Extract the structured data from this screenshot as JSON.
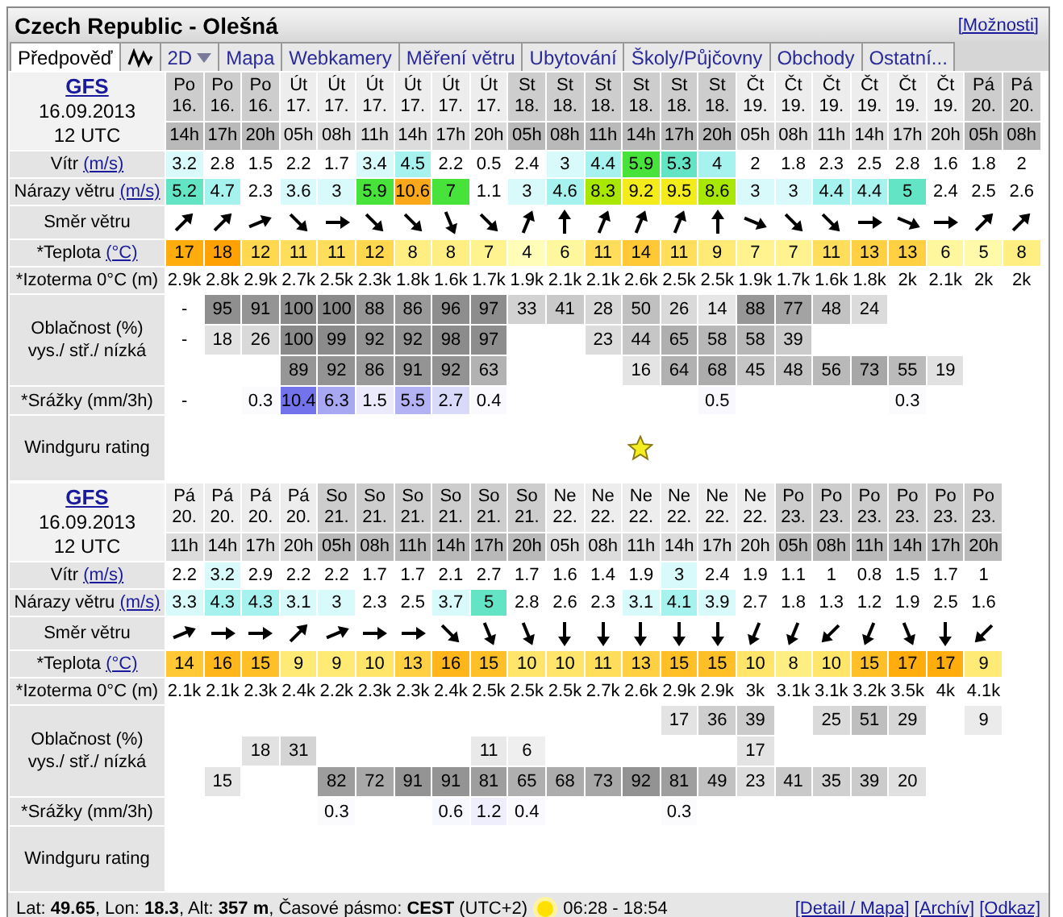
{
  "title": "Czech Republic - Olešná",
  "options_link": "[Možnosti]",
  "tabs": [
    {
      "kind": "text",
      "label": "Předpověď",
      "selected": true
    },
    {
      "kind": "graph",
      "selected": false
    },
    {
      "kind": "dropdown",
      "label": "2D",
      "selected": false
    },
    {
      "kind": "text",
      "label": "Mapa",
      "selected": false
    },
    {
      "kind": "text",
      "label": "Webkamery",
      "selected": false
    },
    {
      "kind": "text",
      "label": "Měření větru",
      "selected": false
    },
    {
      "kind": "text",
      "label": "Ubytování",
      "selected": false
    },
    {
      "kind": "text",
      "label": "Školy/Půjčovny",
      "selected": false
    },
    {
      "kind": "text",
      "label": "Obchody",
      "selected": false
    },
    {
      "kind": "text",
      "label": "Ostatní...",
      "selected": false
    }
  ],
  "blocks": [
    {
      "model": "GFS",
      "run_date": "16.09.2013",
      "run_time": "12 UTC",
      "labels": {
        "wind": "Vítr",
        "wind_unit": "(m/s)",
        "gusts": "Nárazy větru",
        "gusts_unit": "(m/s)",
        "direction": "Směr větru",
        "temperature": "*Teplota",
        "temperature_unit": "(°C)",
        "isotherm": "*Izoterma 0°C (m)",
        "cloud": "Oblačnost (%)",
        "cloud_levels": "vys./ stř./ nízká",
        "precipitation": "*Srážky (mm/3h)",
        "rating": "Windguru rating"
      },
      "columns": [
        {
          "day": "Po",
          "date": "16.",
          "hour": "14h",
          "shaded": true,
          "wind": "3.2",
          "gust": "5.2",
          "arrow": {
            "kind": "ne"
          },
          "temp": "17",
          "iso": "2.9k",
          "cloud_high": "-",
          "cloud_mid": "-",
          "rain": "-"
        },
        {
          "day": "Po",
          "date": "16.",
          "hour": "17h",
          "shaded": true,
          "wind": "2.8",
          "gust": "4.7",
          "arrow": {
            "kind": "ne"
          },
          "temp": "18",
          "iso": "2.8k",
          "cloud_high": "95",
          "cloud_mid": "18"
        },
        {
          "day": "Po",
          "date": "16.",
          "hour": "20h",
          "shaded": true,
          "wind": "1.5",
          "gust": "2.3",
          "arrow": {
            "kind": "ene"
          },
          "temp": "12",
          "iso": "2.9k",
          "cloud_high": "91",
          "cloud_mid": "26",
          "rain": "0.3"
        },
        {
          "day": "Út",
          "date": "17.",
          "hour": "05h",
          "shaded": false,
          "wind": "2.2",
          "gust": "3.6",
          "arrow": {
            "kind": "se"
          },
          "temp": "11",
          "iso": "2.7k",
          "cloud_high": "100",
          "cloud_mid": "100",
          "cloud_low": "89",
          "rain": "10.4"
        },
        {
          "day": "Út",
          "date": "17.",
          "hour": "08h",
          "shaded": false,
          "wind": "1.7",
          "gust": "3",
          "arrow": {
            "kind": "e"
          },
          "temp": "11",
          "iso": "2.5k",
          "cloud_high": "100",
          "cloud_mid": "99",
          "cloud_low": "92",
          "rain": "6.3"
        },
        {
          "day": "Út",
          "date": "17.",
          "hour": "11h",
          "shaded": false,
          "wind": "3.4",
          "gust": "5.9",
          "arrow": {
            "kind": "se"
          },
          "temp": "12",
          "iso": "2.3k",
          "cloud_high": "88",
          "cloud_mid": "92",
          "cloud_low": "86",
          "rain": "1.5"
        },
        {
          "day": "Út",
          "date": "17.",
          "hour": "14h",
          "shaded": false,
          "wind": "4.5",
          "gust": "10.6",
          "arrow": {
            "kind": "se"
          },
          "temp": "8",
          "iso": "1.8k",
          "cloud_high": "86",
          "cloud_mid": "92",
          "cloud_low": "91",
          "rain": "5.5"
        },
        {
          "day": "Út",
          "date": "17.",
          "hour": "17h",
          "shaded": false,
          "wind": "2.2",
          "gust": "7",
          "arrow": {
            "kind": "sse"
          },
          "temp": "8",
          "iso": "1.6k",
          "cloud_high": "96",
          "cloud_mid": "98",
          "cloud_low": "92",
          "rain": "2.7"
        },
        {
          "day": "Út",
          "date": "17.",
          "hour": "20h",
          "shaded": false,
          "wind": "0.5",
          "gust": "1.1",
          "arrow": {
            "kind": "se"
          },
          "temp": "7",
          "iso": "1.7k",
          "cloud_high": "97",
          "cloud_mid": "97",
          "cloud_low": "63",
          "rain": "0.4"
        },
        {
          "day": "St",
          "date": "18.",
          "hour": "05h",
          "shaded": true,
          "wind": "2.4",
          "gust": "3",
          "arrow": {
            "kind": "nne"
          },
          "temp": "4",
          "iso": "1.9k",
          "cloud_high": "33"
        },
        {
          "day": "St",
          "date": "18.",
          "hour": "08h",
          "shaded": true,
          "wind": "3",
          "gust": "4.6",
          "arrow": {
            "kind": "n"
          },
          "temp": "6",
          "iso": "2.1k",
          "cloud_high": "41"
        },
        {
          "day": "St",
          "date": "18.",
          "hour": "11h",
          "shaded": true,
          "wind": "4.4",
          "gust": "8.3",
          "arrow": {
            "kind": "nne"
          },
          "temp": "11",
          "iso": "2.1k",
          "cloud_high": "28",
          "cloud_mid": "23"
        },
        {
          "day": "St",
          "date": "18.",
          "hour": "14h",
          "shaded": true,
          "wind": "5.9",
          "gust": "9.2",
          "arrow": {
            "kind": "nne"
          },
          "temp": "14",
          "iso": "2.6k",
          "cloud_high": "50",
          "cloud_mid": "44",
          "cloud_low": "16",
          "rating": {
            "kind": "star"
          }
        },
        {
          "day": "St",
          "date": "18.",
          "hour": "17h",
          "shaded": true,
          "wind": "5.3",
          "gust": "9.5",
          "arrow": {
            "kind": "nne"
          },
          "temp": "11",
          "iso": "2.5k",
          "cloud_high": "26",
          "cloud_mid": "65",
          "cloud_low": "64"
        },
        {
          "day": "St",
          "date": "18.",
          "hour": "20h",
          "shaded": true,
          "wind": "4",
          "gust": "8.6",
          "arrow": {
            "kind": "n"
          },
          "temp": "9",
          "iso": "2.5k",
          "cloud_high": "14",
          "cloud_mid": "58",
          "cloud_low": "68",
          "rain": "0.5"
        },
        {
          "day": "Čt",
          "date": "19.",
          "hour": "05h",
          "shaded": false,
          "wind": "2",
          "gust": "3",
          "arrow": {
            "kind": "ese"
          },
          "temp": "7",
          "iso": "1.9k",
          "cloud_high": "88",
          "cloud_mid": "58",
          "cloud_low": "45"
        },
        {
          "day": "Čt",
          "date": "19.",
          "hour": "08h",
          "shaded": false,
          "wind": "1.8",
          "gust": "3",
          "arrow": {
            "kind": "se"
          },
          "temp": "7",
          "iso": "1.7k",
          "cloud_high": "77",
          "cloud_mid": "39",
          "cloud_low": "48"
        },
        {
          "day": "Čt",
          "date": "19.",
          "hour": "11h",
          "shaded": false,
          "wind": "2.3",
          "gust": "4.4",
          "arrow": {
            "kind": "se"
          },
          "temp": "11",
          "iso": "1.6k",
          "cloud_high": "48",
          "cloud_low": "56"
        },
        {
          "day": "Čt",
          "date": "19.",
          "hour": "14h",
          "shaded": false,
          "wind": "2.5",
          "gust": "4.4",
          "arrow": {
            "kind": "e"
          },
          "temp": "13",
          "iso": "1.8k",
          "cloud_high": "24",
          "cloud_low": "73"
        },
        {
          "day": "Čt",
          "date": "19.",
          "hour": "17h",
          "shaded": false,
          "wind": "2.8",
          "gust": "5",
          "arrow": {
            "kind": "ese"
          },
          "temp": "13",
          "iso": "2k",
          "cloud_low": "55",
          "rain": "0.3"
        },
        {
          "day": "Čt",
          "date": "19.",
          "hour": "20h",
          "shaded": false,
          "wind": "1.6",
          "gust": "2.4",
          "arrow": {
            "kind": "e"
          },
          "temp": "6",
          "iso": "2.1k",
          "cloud_low": "19"
        },
        {
          "day": "Pá",
          "date": "20.",
          "hour": "05h",
          "shaded": true,
          "wind": "1.8",
          "gust": "2.5",
          "arrow": {
            "kind": "ne"
          },
          "temp": "5",
          "iso": "2k"
        },
        {
          "day": "Pá",
          "date": "20.",
          "hour": "08h",
          "shaded": true,
          "wind": "2",
          "gust": "2.6",
          "arrow": {
            "kind": "ne"
          },
          "temp": "8",
          "iso": "2k"
        }
      ]
    },
    {
      "model": "GFS",
      "run_date": "16.09.2013",
      "run_time": "12 UTC",
      "labels": {
        "wind": "Vítr",
        "wind_unit": "(m/s)",
        "gusts": "Nárazy větru",
        "gusts_unit": "(m/s)",
        "direction": "Směr větru",
        "temperature": "*Teplota",
        "temperature_unit": "(°C)",
        "isotherm": "*Izoterma 0°C (m)",
        "cloud": "Oblačnost (%)",
        "cloud_levels": "vys./ stř./ nízká",
        "precipitation": "*Srážky (mm/3h)",
        "rating": "Windguru rating"
      },
      "columns": [
        {
          "day": "Pá",
          "date": "20.",
          "hour": "11h",
          "shaded": false,
          "wind": "2.2",
          "gust": "3.3",
          "arrow": {
            "kind": "ene"
          },
          "temp": "14",
          "iso": "2.1k"
        },
        {
          "day": "Pá",
          "date": "20.",
          "hour": "14h",
          "shaded": false,
          "wind": "3.2",
          "gust": "4.3",
          "arrow": {
            "kind": "e"
          },
          "temp": "16",
          "iso": "2.1k",
          "cloud_low": "15"
        },
        {
          "day": "Pá",
          "date": "20.",
          "hour": "17h",
          "shaded": false,
          "wind": "2.9",
          "gust": "4.3",
          "arrow": {
            "kind": "e"
          },
          "temp": "15",
          "iso": "2.3k",
          "cloud_mid": "18"
        },
        {
          "day": "Pá",
          "date": "20.",
          "hour": "20h",
          "shaded": false,
          "wind": "2.2",
          "gust": "3.1",
          "arrow": {
            "kind": "ne"
          },
          "temp": "9",
          "iso": "2.4k",
          "cloud_mid": "31"
        },
        {
          "day": "So",
          "date": "21.",
          "hour": "05h",
          "shaded": true,
          "wind": "2.2",
          "gust": "3",
          "arrow": {
            "kind": "ene"
          },
          "temp": "9",
          "iso": "2.2k",
          "cloud_low": "82",
          "rain": "0.3"
        },
        {
          "day": "So",
          "date": "21.",
          "hour": "08h",
          "shaded": true,
          "wind": "1.7",
          "gust": "2.3",
          "arrow": {
            "kind": "e"
          },
          "temp": "10",
          "iso": "2.3k",
          "cloud_low": "72"
        },
        {
          "day": "So",
          "date": "21.",
          "hour": "11h",
          "shaded": true,
          "wind": "1.7",
          "gust": "2.5",
          "arrow": {
            "kind": "e"
          },
          "temp": "13",
          "iso": "2.3k",
          "cloud_low": "91"
        },
        {
          "day": "So",
          "date": "21.",
          "hour": "14h",
          "shaded": true,
          "wind": "2.1",
          "gust": "3.7",
          "arrow": {
            "kind": "se"
          },
          "temp": "16",
          "iso": "2.4k",
          "cloud_low": "91",
          "rain": "0.6"
        },
        {
          "day": "So",
          "date": "21.",
          "hour": "17h",
          "shaded": true,
          "wind": "2.7",
          "gust": "5",
          "arrow": {
            "kind": "sse"
          },
          "temp": "15",
          "iso": "2.5k",
          "cloud_mid": "11",
          "cloud_low": "81",
          "rain": "1.2"
        },
        {
          "day": "So",
          "date": "21.",
          "hour": "20h",
          "shaded": true,
          "wind": "1.7",
          "gust": "2.8",
          "arrow": {
            "kind": "sse"
          },
          "temp": "10",
          "iso": "2.5k",
          "cloud_mid": "6",
          "cloud_low": "65",
          "rain": "0.4"
        },
        {
          "day": "Ne",
          "date": "22.",
          "hour": "05h",
          "shaded": false,
          "wind": "1.6",
          "gust": "2.6",
          "arrow": {
            "kind": "s"
          },
          "temp": "10",
          "iso": "2.5k",
          "cloud_low": "68"
        },
        {
          "day": "Ne",
          "date": "22.",
          "hour": "08h",
          "shaded": false,
          "wind": "1.4",
          "gust": "2.3",
          "arrow": {
            "kind": "s"
          },
          "temp": "11",
          "iso": "2.7k",
          "cloud_low": "73"
        },
        {
          "day": "Ne",
          "date": "22.",
          "hour": "11h",
          "shaded": false,
          "wind": "1.9",
          "gust": "3.1",
          "arrow": {
            "kind": "s"
          },
          "temp": "13",
          "iso": "2.6k",
          "cloud_low": "92"
        },
        {
          "day": "Ne",
          "date": "22.",
          "hour": "14h",
          "shaded": false,
          "wind": "3",
          "gust": "4.1",
          "arrow": {
            "kind": "s"
          },
          "temp": "15",
          "iso": "2.9k",
          "cloud_high": "17",
          "cloud_low": "81",
          "rain": "0.3"
        },
        {
          "day": "Ne",
          "date": "22.",
          "hour": "17h",
          "shaded": false,
          "wind": "2.4",
          "gust": "3.9",
          "arrow": {
            "kind": "s"
          },
          "temp": "15",
          "iso": "2.9k",
          "cloud_high": "36",
          "cloud_low": "49"
        },
        {
          "day": "Ne",
          "date": "22.",
          "hour": "20h",
          "shaded": false,
          "wind": "1.9",
          "gust": "2.7",
          "arrow": {
            "kind": "ssw"
          },
          "temp": "10",
          "iso": "3k",
          "cloud_high": "39",
          "cloud_mid": "17",
          "cloud_low": "23"
        },
        {
          "day": "Po",
          "date": "23.",
          "hour": "05h",
          "shaded": true,
          "wind": "1.1",
          "gust": "1.8",
          "arrow": {
            "kind": "ssw"
          },
          "temp": "8",
          "iso": "3.1k",
          "cloud_low": "41"
        },
        {
          "day": "Po",
          "date": "23.",
          "hour": "08h",
          "shaded": true,
          "wind": "1",
          "gust": "1.3",
          "arrow": {
            "kind": "sw"
          },
          "temp": "10",
          "iso": "3.1k",
          "cloud_high": "25",
          "cloud_low": "35"
        },
        {
          "day": "Po",
          "date": "23.",
          "hour": "11h",
          "shaded": true,
          "wind": "0.8",
          "gust": "1.2",
          "arrow": {
            "kind": "ssw"
          },
          "temp": "15",
          "iso": "3.2k",
          "cloud_high": "51",
          "cloud_low": "39"
        },
        {
          "day": "Po",
          "date": "23.",
          "hour": "14h",
          "shaded": true,
          "wind": "1.5",
          "gust": "1.9",
          "arrow": {
            "kind": "sse"
          },
          "temp": "17",
          "iso": "3.5k",
          "cloud_high": "29",
          "cloud_low": "20"
        },
        {
          "day": "Po",
          "date": "23.",
          "hour": "17h",
          "shaded": true,
          "wind": "1.7",
          "gust": "2.5",
          "arrow": {
            "kind": "s"
          },
          "temp": "17",
          "iso": "4k"
        },
        {
          "day": "Po",
          "date": "23.",
          "hour": "20h",
          "shaded": true,
          "wind": "1",
          "gust": "1.6",
          "arrow": {
            "kind": "sw"
          },
          "temp": "9",
          "iso": "4.1k",
          "cloud_high": "9"
        }
      ]
    }
  ],
  "footer": {
    "location": "Lat: **49.65**, Lon: **18.3**, Alt: **357 m**, Časové pásmo: **CEST** (UTC+2)",
    "sun_times": "06:28 - 18:54",
    "links": [
      "[Detail / Mapa]",
      "[Archív]",
      "[Odkaz]"
    ]
  }
}
